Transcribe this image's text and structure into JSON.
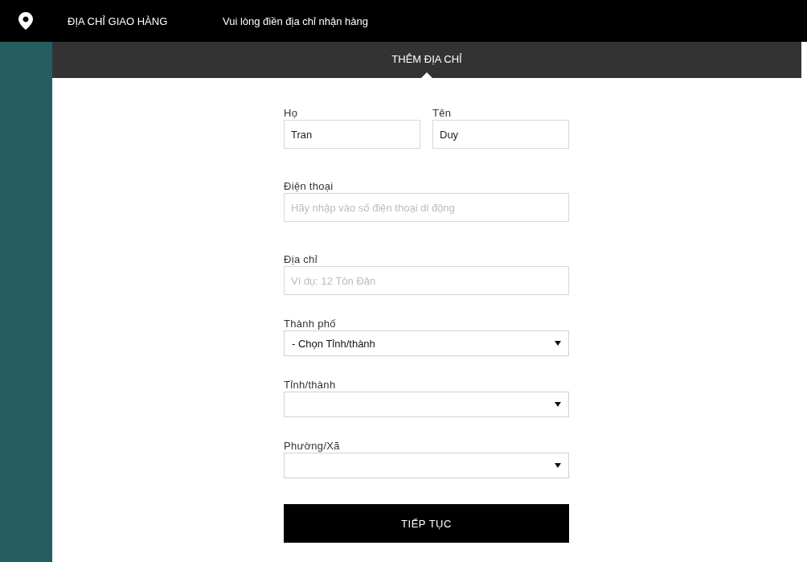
{
  "header": {
    "title": "ĐỊA CHỈ GIAO HÀNG",
    "subtitle": "Vui lòng điền địa chỉ nhận hàng"
  },
  "tab": {
    "label": "THÊM ĐỊA CHỈ"
  },
  "name_row": [
    {
      "label": "Họ",
      "value": "Tran"
    },
    {
      "label": "Tên",
      "value": "Duy"
    }
  ],
  "fields": [
    {
      "kind": "text",
      "label": "Điện thoại",
      "placeholder": "Hãy nhập vào số điện thoại di động"
    },
    {
      "kind": "text",
      "label": "Địa chỉ",
      "placeholder": "Ví dụ: 12 Tôn Đản"
    },
    {
      "kind": "select",
      "label": "Thành phố",
      "value": "- Chọn Tỉnh/thành"
    },
    {
      "kind": "select",
      "label": "Tỉnh/thành"
    },
    {
      "kind": "select",
      "label": "Phường/Xã"
    }
  ],
  "submit": "TIẾP TỤC"
}
